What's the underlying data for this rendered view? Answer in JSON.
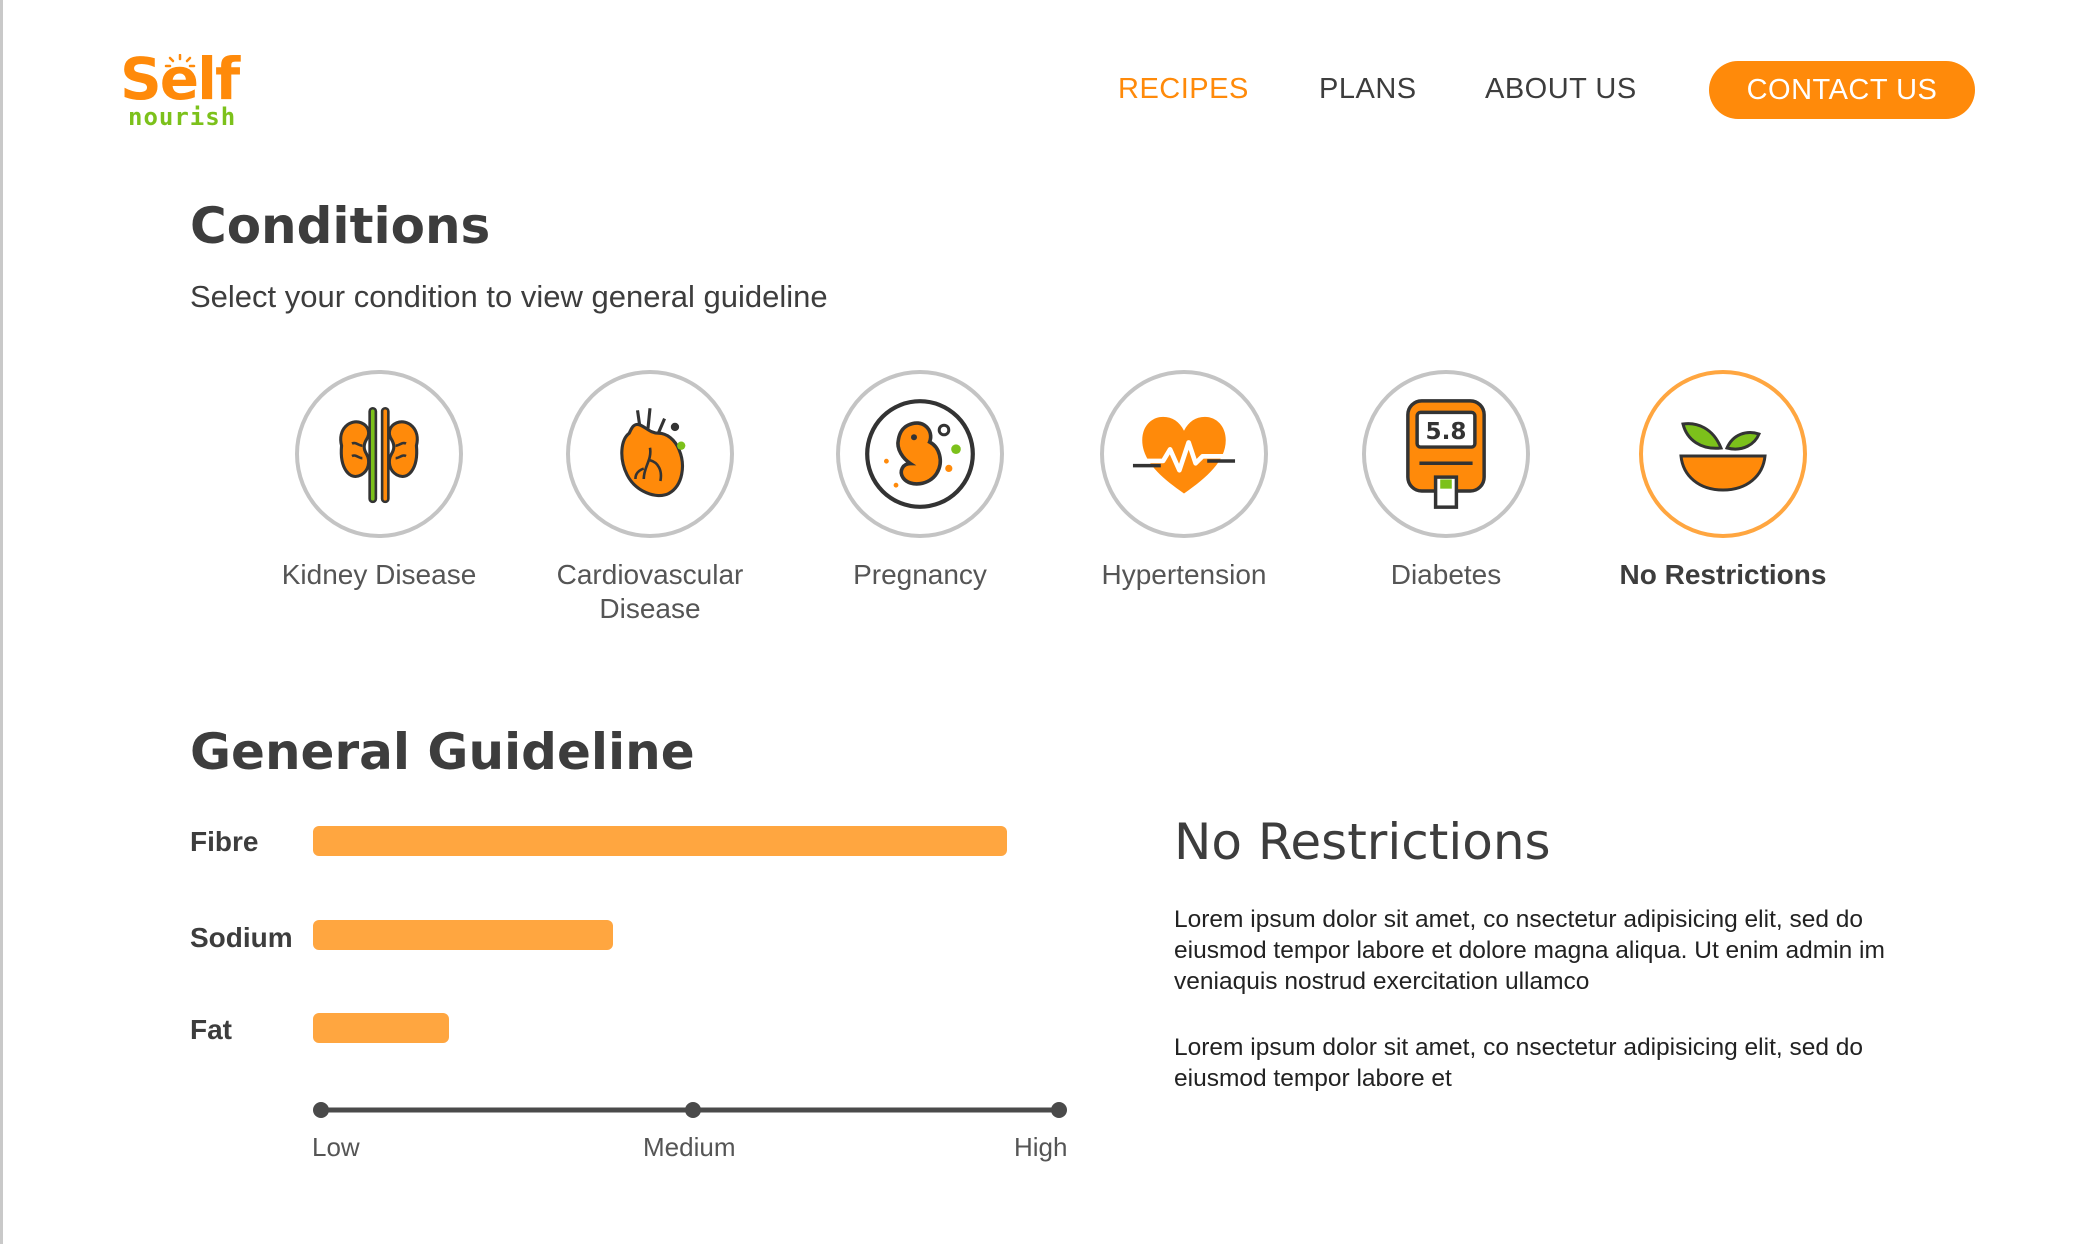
{
  "brand": {
    "logo_top": "Self",
    "logo_bottom": "nourish",
    "primary": "#ff8a0a",
    "secondary": "#7cc11b"
  },
  "nav": {
    "items": [
      {
        "label": "RECIPES",
        "active": true
      },
      {
        "label": "PLANS",
        "active": false
      },
      {
        "label": "ABOUT US",
        "active": false
      }
    ],
    "contact_label": "CONTACT US"
  },
  "conditions": {
    "title": "Conditions",
    "subtitle": "Select your condition to view general guideline",
    "items": [
      {
        "label": "Kidney Disease",
        "icon": "kidney-icon",
        "selected": false
      },
      {
        "label": "Cardiovascular Disease",
        "icon": "heart-organ-icon",
        "selected": false
      },
      {
        "label": "Pregnancy",
        "icon": "fetus-icon",
        "selected": false
      },
      {
        "label": "Hypertension",
        "icon": "heartbeat-icon",
        "selected": false
      },
      {
        "label": "Diabetes",
        "icon": "glucose-meter-icon",
        "reading": "5.8",
        "selected": false
      },
      {
        "label": "No Restrictions",
        "icon": "salad-bowl-icon",
        "selected": true
      }
    ]
  },
  "guideline": {
    "title": "General Guideline",
    "bar_color": "#ffa640",
    "bars": [
      {
        "label": "Fibre",
        "level": 0.97
      },
      {
        "label": "Sodium",
        "level": 0.42
      },
      {
        "label": "Fat",
        "level": 0.19
      }
    ],
    "scale": {
      "low": "Low",
      "medium": "Medium",
      "high": "High"
    }
  },
  "detail": {
    "title": "No Restrictions",
    "paragraphs": [
      "Lorem ipsum dolor sit amet, co nsectetur adipisicing elit, sed do eiusmod tempor labore et dolore magna aliqua. Ut enim admin im veniaquis nostrud exercitation ullamco",
      "Lorem ipsum dolor sit amet, co nsectetur adipisicing elit, sed do eiusmod tempor labore et"
    ]
  }
}
